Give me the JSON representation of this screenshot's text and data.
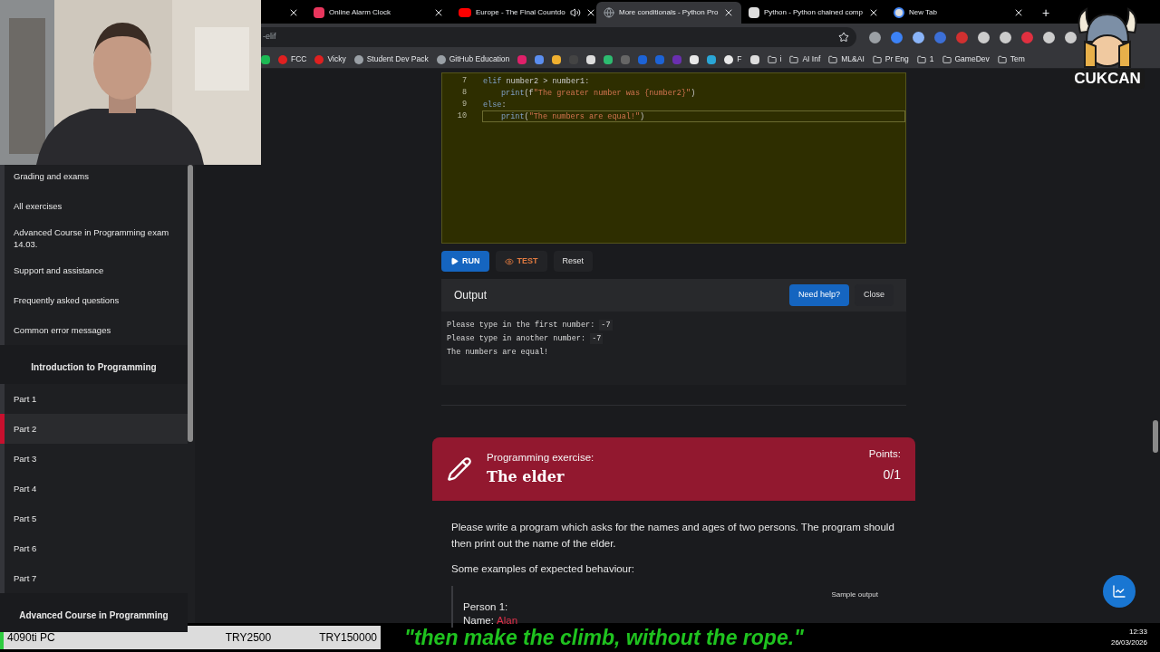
{
  "browser": {
    "tabs": [
      {
        "selected": false,
        "audio": false
      },
      {
        "title": "Online Alarm Clock",
        "selected": false,
        "audio": false
      },
      {
        "title": "Europe - The Final Countdo",
        "selected": false,
        "audio": true
      },
      {
        "title": "More conditionals - Python Pro",
        "selected": true,
        "audio": false
      },
      {
        "title": "Python - Python chained comp",
        "selected": false,
        "audio": false
      },
      {
        "title": "New Tab",
        "selected": false,
        "audio": false
      }
    ],
    "new_tab": "+",
    "address_bar": {
      "value": "-elif"
    },
    "bookmarks": [
      {
        "kind": "icon",
        "color": "#1db954"
      },
      {
        "kind": "site",
        "label": "FCC",
        "color": "#e02020"
      },
      {
        "kind": "site",
        "label": "Vicky",
        "color": "#e02020"
      },
      {
        "kind": "site",
        "label": "Student Dev Pack",
        "color": "#9aa0a6"
      },
      {
        "kind": "site",
        "label": "GitHub Education",
        "color": "#9aa0a6"
      },
      {
        "kind": "icon",
        "color": "#e0206a"
      },
      {
        "kind": "icon",
        "color": "#5b8ef0"
      },
      {
        "kind": "icon",
        "color": "#f0b030"
      },
      {
        "kind": "icon",
        "color": "#444444"
      },
      {
        "kind": "icon",
        "color": "#dddddd"
      },
      {
        "kind": "icon",
        "color": "#2dbb70"
      },
      {
        "kind": "icon",
        "color": "#666666"
      },
      {
        "kind": "icon",
        "color": "#1d63d6"
      },
      {
        "kind": "icon",
        "color": "#1d63d6"
      },
      {
        "kind": "icon",
        "color": "#6a2fb0"
      },
      {
        "kind": "icon",
        "color": "#e8e8e8"
      },
      {
        "kind": "icon",
        "color": "#2aa6d6"
      },
      {
        "kind": "site",
        "label": "F",
        "color": "#e8e8e8"
      },
      {
        "kind": "icon",
        "color": "#dddddd"
      },
      {
        "kind": "folder",
        "label": "i"
      },
      {
        "kind": "folder",
        "label": "AI Inf"
      },
      {
        "kind": "folder",
        "label": "ML&AI"
      },
      {
        "kind": "folder",
        "label": "Pr Eng"
      },
      {
        "kind": "folder",
        "label": "1"
      },
      {
        "kind": "folder",
        "label": "GameDev"
      },
      {
        "kind": "folder",
        "label": "Tem"
      }
    ]
  },
  "logo": {
    "text": "CUKCAN"
  },
  "sidebar": {
    "items": [
      {
        "kind": "link",
        "label": "Grading and exams",
        "selected": false
      },
      {
        "kind": "link",
        "label": "All exercises",
        "selected": false
      },
      {
        "kind": "link",
        "label": "Advanced Course in Programming exam 14.03.",
        "selected": false
      },
      {
        "kind": "link",
        "label": "Support and assistance",
        "selected": false
      },
      {
        "kind": "link",
        "label": "Frequently asked questions",
        "selected": false
      },
      {
        "kind": "link",
        "label": "Common error messages",
        "selected": false
      },
      {
        "kind": "heading",
        "label": "Introduction to Programming"
      },
      {
        "kind": "link",
        "label": "Part 1",
        "selected": false
      },
      {
        "kind": "link",
        "label": "Part 2",
        "selected": true
      },
      {
        "kind": "link",
        "label": "Part 3",
        "selected": false
      },
      {
        "kind": "link",
        "label": "Part 4",
        "selected": false
      },
      {
        "kind": "link",
        "label": "Part 5",
        "selected": false
      },
      {
        "kind": "link",
        "label": "Part 6",
        "selected": false
      },
      {
        "kind": "link",
        "label": "Part 7",
        "selected": false
      },
      {
        "kind": "heading",
        "label": "Advanced Course in Programming"
      }
    ]
  },
  "editor": {
    "lines": [
      {
        "number": "7",
        "indented": false,
        "current": false,
        "tokens": [
          {
            "kind": "keyword",
            "text": "elif"
          },
          {
            "kind": "plain",
            "text": " number2 > number1:"
          }
        ]
      },
      {
        "number": "8",
        "indented": true,
        "current": false,
        "tokens": [
          {
            "kind": "function",
            "text": "print"
          },
          {
            "kind": "plain",
            "text": "(f"
          },
          {
            "kind": "string",
            "text": "\"The greater number was {number2}\""
          },
          {
            "kind": "plain",
            "text": ")"
          }
        ]
      },
      {
        "number": "9",
        "indented": false,
        "current": false,
        "tokens": [
          {
            "kind": "keyword",
            "text": "else"
          },
          {
            "kind": "plain",
            "text": ":"
          }
        ]
      },
      {
        "number": "10",
        "indented": true,
        "current": true,
        "tokens": [
          {
            "kind": "function",
            "text": "print"
          },
          {
            "kind": "plain",
            "text": "("
          },
          {
            "kind": "string",
            "text": "\"The numbers are equal!\""
          },
          {
            "kind": "plain",
            "text": ")"
          }
        ]
      }
    ]
  },
  "actions": [
    {
      "kind": "run",
      "label": "RUN"
    },
    {
      "kind": "test",
      "label": "TEST"
    },
    {
      "kind": "reset",
      "label": "Reset"
    }
  ],
  "output": {
    "title": "Output",
    "buttons": [
      {
        "kind": "primary",
        "label": "Need help?"
      },
      {
        "kind": "secondary",
        "label": "Close"
      }
    ],
    "lines": [
      {
        "text": "Please type in the first number: ",
        "input": "-7"
      },
      {
        "text": "Please type in another number: ",
        "input": "-7"
      },
      {
        "text": "The numbers are equal!"
      }
    ]
  },
  "exercise": {
    "label": "Programming exercise:",
    "title": "The elder",
    "points_label": "Points:",
    "points": "0/1",
    "paragraphs": [
      "Please write a program which asks for the names and ages of two persons. The program should then print out the name of the elder.",
      "Some examples of expected behaviour:"
    ],
    "sample": {
      "label": "Sample output",
      "lines": [
        {
          "text": "Person 1:"
        },
        {
          "text": "Name: ",
          "input": "Alan"
        }
      ]
    }
  },
  "status_bar": {
    "machine": "4090ti PC",
    "values": [
      "TRY2500",
      "TRY150000"
    ],
    "quote": "\"then make the climb, without the rope.\"",
    "time": "12:33",
    "date": "26/03/2026"
  }
}
